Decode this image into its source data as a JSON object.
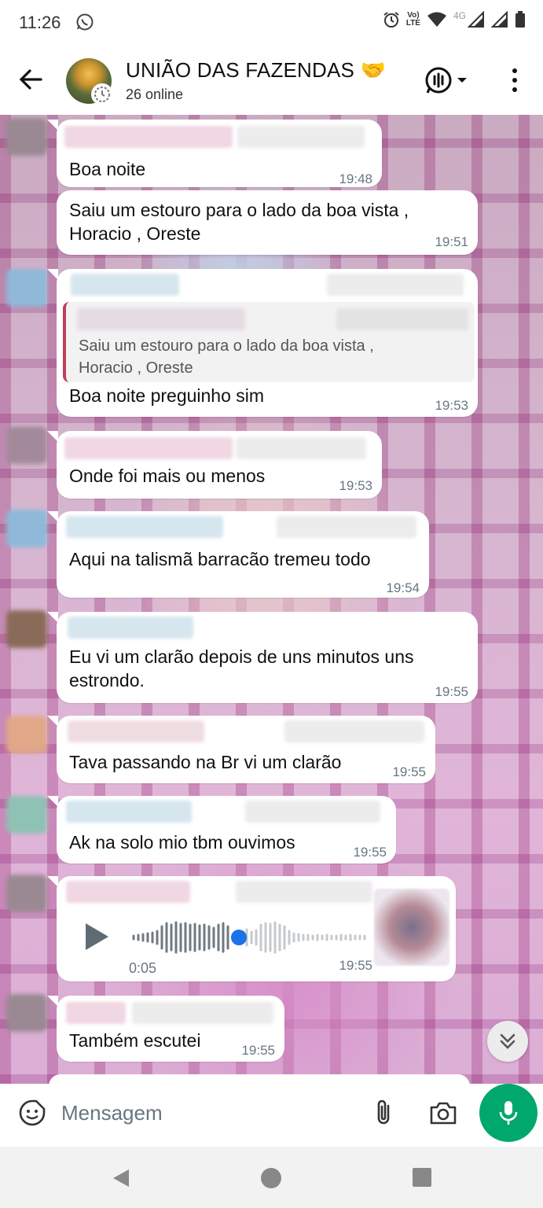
{
  "status_bar": {
    "time": "11:26",
    "network_label_top": "Vo)",
    "network_label_bottom": "LTE",
    "network_4g": "4G"
  },
  "header": {
    "title": "UNIÃO DAS FAZENDAS 🤝",
    "subtitle": "26 online"
  },
  "messages": [
    {
      "text": "Boa noite",
      "time": "19:48"
    },
    {
      "text_line1": "Saiu um estouro para o lado da boa vista ,",
      "text_line2": "Horacio , Oreste",
      "time": "19:51"
    },
    {
      "quote_line1": "Saiu um estouro para o lado da boa vista ,",
      "quote_line2": "Horacio , Oreste",
      "text": "Boa noite preguinho sim",
      "time": "19:53"
    },
    {
      "text": "Onde foi mais ou menos",
      "time": "19:53"
    },
    {
      "text": "Aqui na talismã barracão tremeu todo",
      "time": "19:54"
    },
    {
      "text_line1": "Eu vi um clarão depois de uns minutos uns",
      "text_line2": "estrondo.",
      "time": "19:55"
    },
    {
      "text": "Tava passando na Br vi um clarão",
      "time": "19:55"
    },
    {
      "text": "Ak na solo mio tbm ouvimos",
      "time": "19:55"
    },
    {
      "voice_duration": "0:05",
      "voice_progress": 0.43,
      "time": "19:55"
    },
    {
      "text": "Também escutei",
      "time": "19:55"
    }
  ],
  "input": {
    "placeholder": "Mensagem"
  },
  "colors": {
    "accent": "#00a86b",
    "quote_bar": "#c23c5c",
    "voice_dot": "#1a73e8"
  }
}
